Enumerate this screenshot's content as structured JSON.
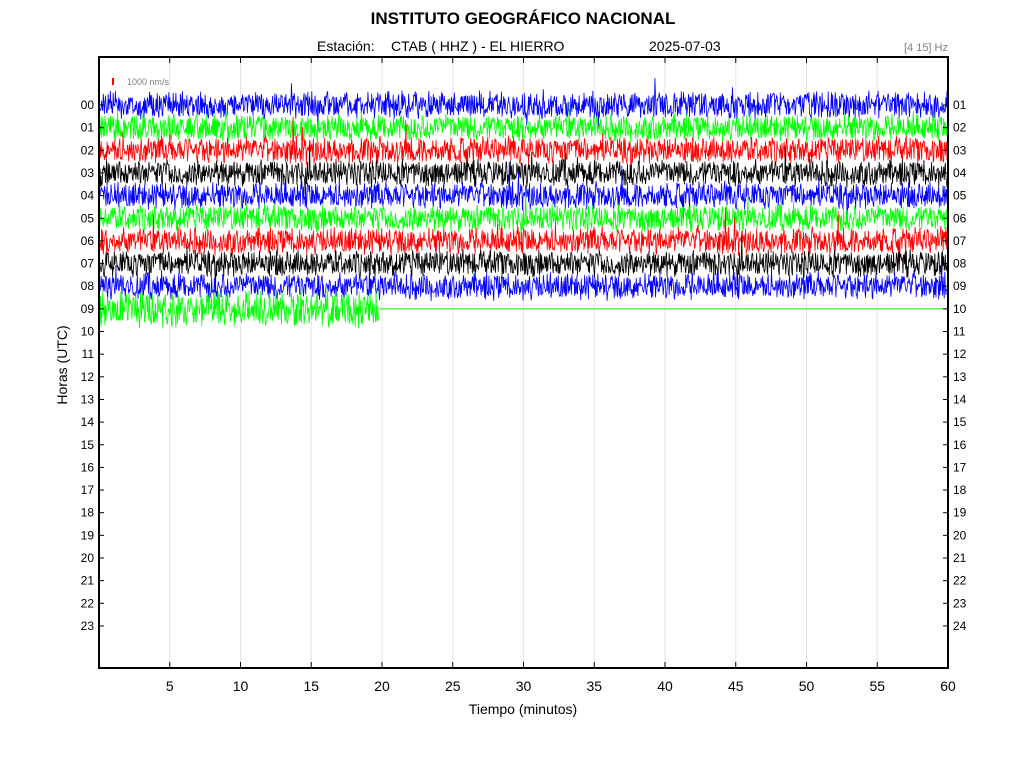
{
  "header": {
    "title": "INSTITUTO GEOGRÁFICO NACIONAL",
    "station_label": "Estación:",
    "station": "CTAB ( HHZ ) - EL HIERRO",
    "date": "2025-07-03",
    "band": "[4 15] Hz"
  },
  "chart_data": {
    "type": "line",
    "title": "INSTITUTO GEOGRÁFICO NACIONAL",
    "xlabel": "Tiempo (minutos)",
    "ylabel": "Horas (UTC)",
    "xlim": [
      0,
      60
    ],
    "x_ticks": [
      "5",
      "10",
      "15",
      "20",
      "25",
      "30",
      "35",
      "40",
      "45",
      "50",
      "55",
      "60"
    ],
    "y_ticks_left": [
      "00",
      "01",
      "02",
      "03",
      "04",
      "05",
      "06",
      "07",
      "08",
      "09",
      "10",
      "11",
      "12",
      "13",
      "14",
      "15",
      "16",
      "17",
      "18",
      "19",
      "20",
      "21",
      "22",
      "23"
    ],
    "y_ticks_right": [
      "01",
      "02",
      "03",
      "04",
      "05",
      "06",
      "07",
      "08",
      "09",
      "10",
      "11",
      "12",
      "13",
      "14",
      "15",
      "16",
      "17",
      "18",
      "19",
      "20",
      "21",
      "22",
      "23",
      "24"
    ],
    "scale_bar": "1000 nm/s",
    "grid": true,
    "trace_colors": [
      "#0000ff",
      "#00ff00",
      "#ff0000",
      "#000000"
    ],
    "series": [
      {
        "hour": 0,
        "color": "#0000ff",
        "end_minute": 60
      },
      {
        "hour": 1,
        "color": "#00ff00",
        "end_minute": 60
      },
      {
        "hour": 2,
        "color": "#ff0000",
        "end_minute": 60
      },
      {
        "hour": 3,
        "color": "#000000",
        "end_minute": 60
      },
      {
        "hour": 4,
        "color": "#0000ff",
        "end_minute": 60
      },
      {
        "hour": 5,
        "color": "#00ff00",
        "end_minute": 60
      },
      {
        "hour": 6,
        "color": "#ff0000",
        "end_minute": 60
      },
      {
        "hour": 7,
        "color": "#000000",
        "end_minute": 60
      },
      {
        "hour": 8,
        "color": "#0000ff",
        "end_minute": 60
      },
      {
        "hour": 9,
        "color": "#00ff00",
        "end_minute": 19.8
      }
    ]
  }
}
